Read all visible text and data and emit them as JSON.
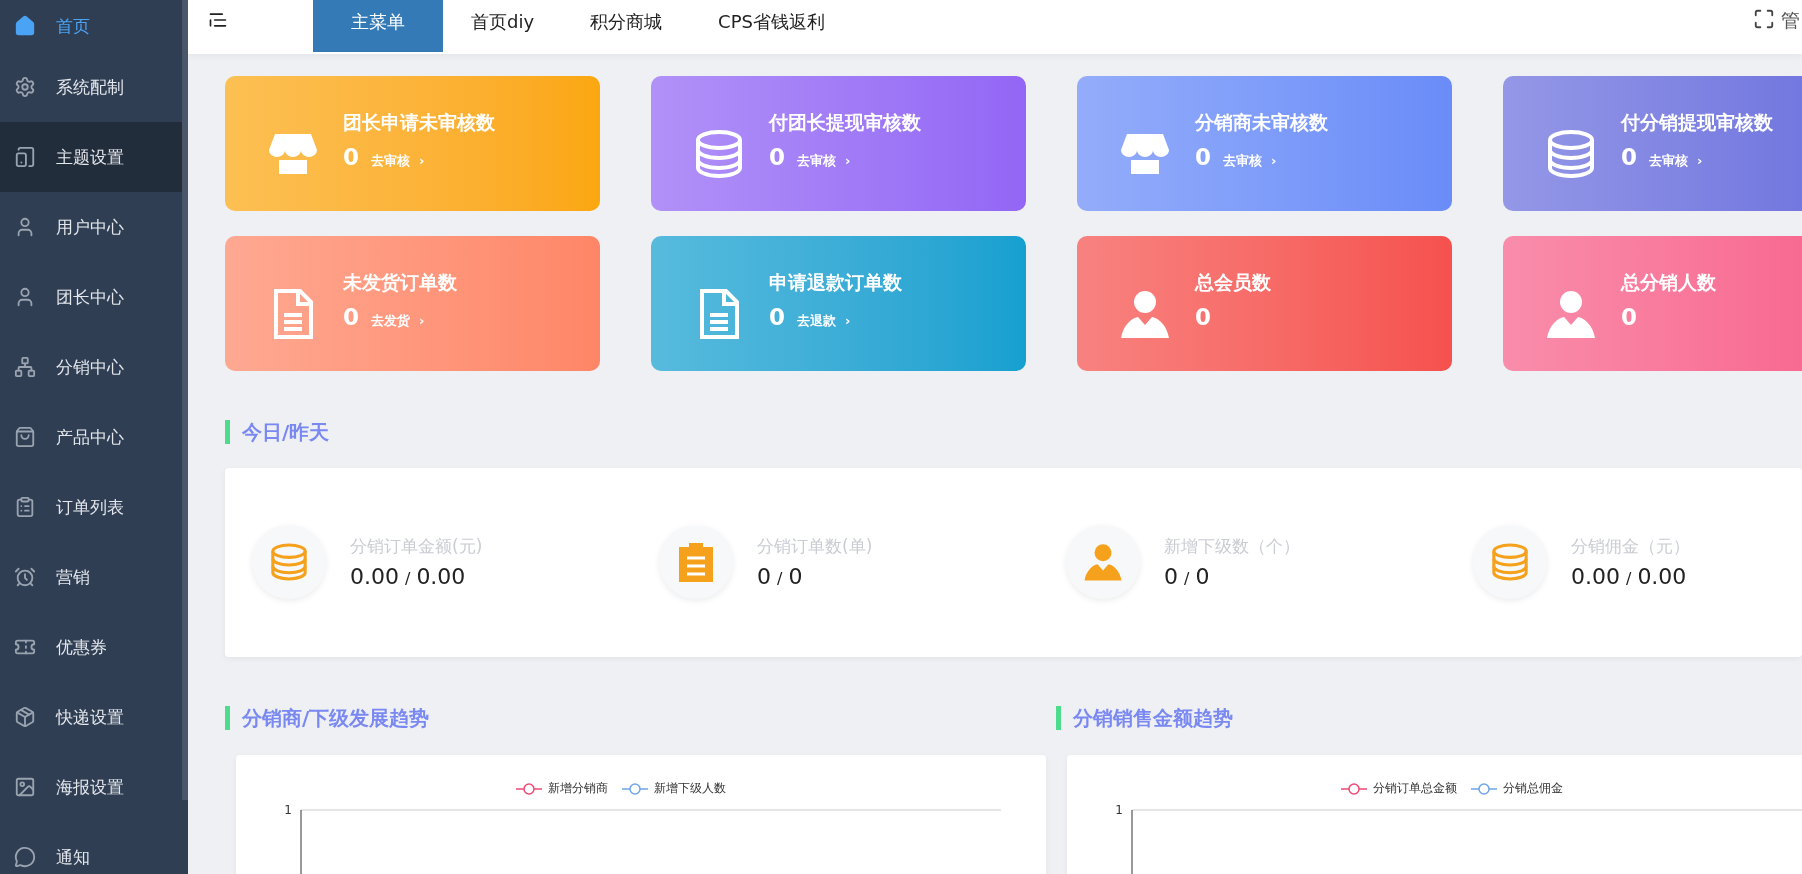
{
  "sidebar": {
    "items": [
      {
        "label": "首页",
        "selected": true,
        "highlighted": false
      },
      {
        "label": "系统配制",
        "selected": false,
        "highlighted": false
      },
      {
        "label": "主题设置",
        "selected": false,
        "highlighted": true
      },
      {
        "label": "用户中心",
        "selected": false,
        "highlighted": false
      },
      {
        "label": "团长中心",
        "selected": false,
        "highlighted": false
      },
      {
        "label": "分销中心",
        "selected": false,
        "highlighted": false
      },
      {
        "label": "产品中心",
        "selected": false,
        "highlighted": false
      },
      {
        "label": "订单列表",
        "selected": false,
        "highlighted": false
      },
      {
        "label": "营销",
        "selected": false,
        "highlighted": false
      },
      {
        "label": "优惠券",
        "selected": false,
        "highlighted": false
      },
      {
        "label": "快递设置",
        "selected": false,
        "highlighted": false
      },
      {
        "label": "海报设置",
        "selected": false,
        "highlighted": false
      },
      {
        "label": "通知",
        "selected": false,
        "highlighted": false
      }
    ]
  },
  "topbar": {
    "tabs": [
      {
        "label": "主菜单",
        "selected": true
      },
      {
        "label": "首页diy",
        "selected": false
      },
      {
        "label": "积分商城",
        "selected": false
      },
      {
        "label": "CPS省钱返利",
        "selected": false
      }
    ],
    "user": "管"
  },
  "cards": [
    {
      "title": "团长申请未审核数",
      "count": "0",
      "link": "去审核",
      "arrow": "›",
      "color": "#fba70f"
    },
    {
      "title": "付团长提现审核数",
      "count": "0",
      "link": "去审核",
      "arrow": "›",
      "color": "#9366f5"
    },
    {
      "title": "分销商未审核数",
      "count": "0",
      "link": "去审核",
      "arrow": "›",
      "color": "#6a8cf8"
    },
    {
      "title": "付分销提现审核数",
      "count": "0",
      "link": "去审核",
      "arrow": "›",
      "color": "#6b6fdd"
    },
    {
      "title": "未发货订单数",
      "count": "0",
      "link": "去发货",
      "arrow": "›",
      "color": "#fe8667"
    },
    {
      "title": "申请退款订单数",
      "count": "0",
      "link": "去退款",
      "arrow": "›",
      "color": "#15a0d0"
    },
    {
      "title": "总会员数",
      "count": "0",
      "color": "#f5514e"
    },
    {
      "title": "总分销人数",
      "count": "0",
      "color": "#f7608a"
    }
  ],
  "today": {
    "heading": "今日/昨天",
    "stats": [
      {
        "label": "分销订单金额(元)",
        "today": "0.00",
        "separator": "/",
        "yesterday": "0.00"
      },
      {
        "label": "分销订单数(单)",
        "today": "0",
        "separator": "/",
        "yesterday": "0"
      },
      {
        "label": "新增下级数（个）",
        "today": "0",
        "separator": "/",
        "yesterday": "0"
      },
      {
        "label": "分销佣金（元）",
        "today": "0.00",
        "separator": "/",
        "yesterday": "0.00"
      }
    ]
  },
  "charts": [
    {
      "heading": "分销商/下级发展趋势",
      "legend": [
        {
          "name": "新增分销商",
          "color": "#ee4a73"
        },
        {
          "name": "新增下级人数",
          "color": "#6ea6e8"
        }
      ],
      "axis_label": "1"
    },
    {
      "heading": "分销销售金额趋势",
      "legend": [
        {
          "name": "分销订单总金额",
          "color": "#ee4a73"
        },
        {
          "name": "分销总佣金",
          "color": "#6ea6e8"
        }
      ],
      "axis_label": "1"
    }
  ]
}
